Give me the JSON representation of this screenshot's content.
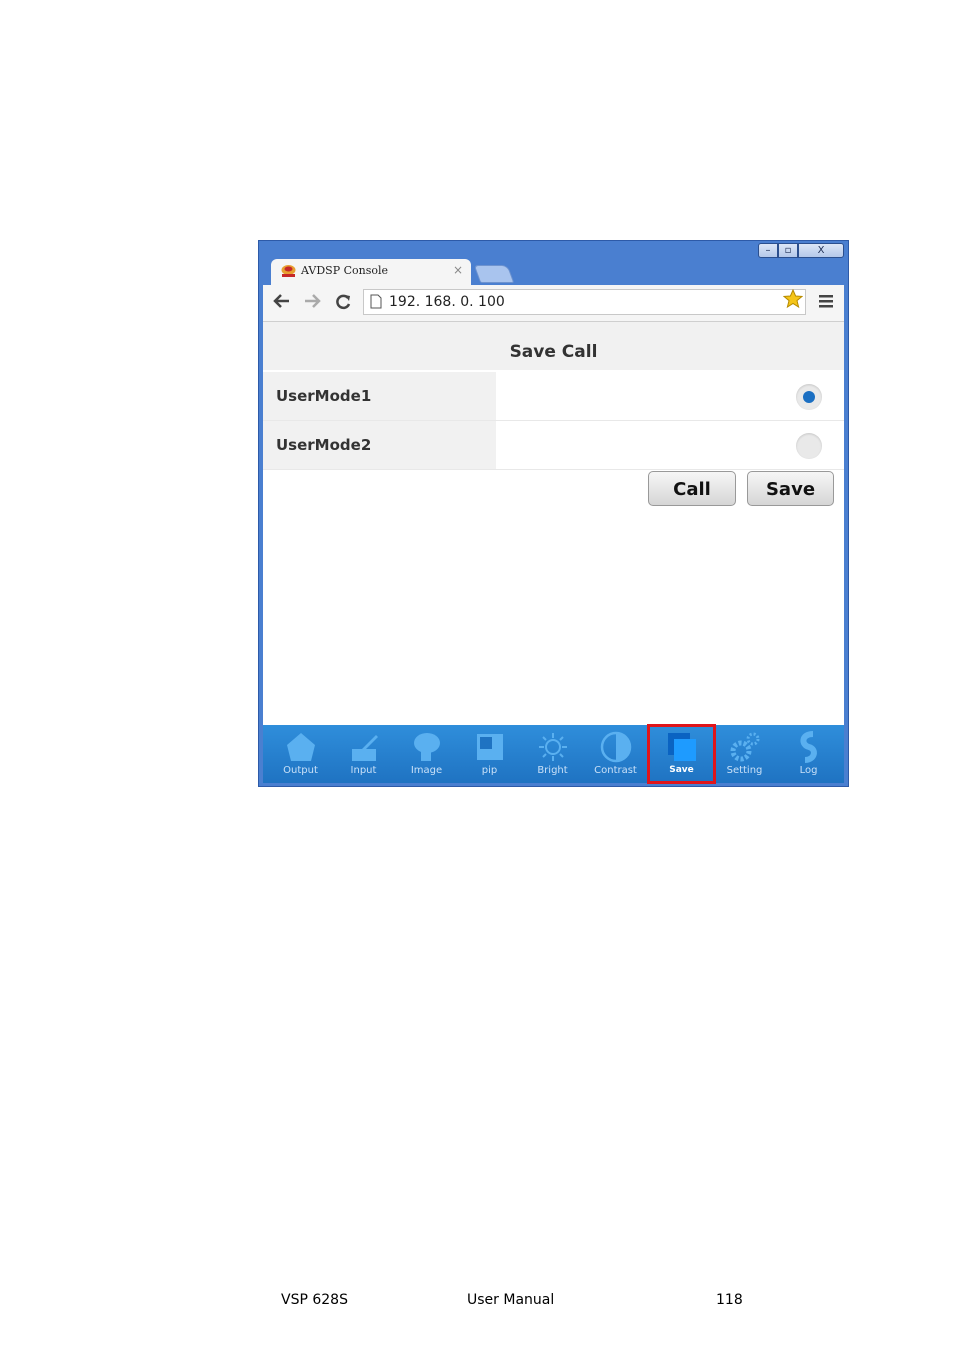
{
  "browser": {
    "tab_title": "AVDSP Console",
    "tab_close": "×",
    "url": "192. 168. 0. 100",
    "window_controls": {
      "close": "X"
    }
  },
  "page": {
    "title": "Save Call",
    "modes": [
      {
        "label": "UserMode1",
        "selected": true
      },
      {
        "label": "UserMode2",
        "selected": false
      }
    ],
    "buttons": {
      "call": "Call",
      "save": "Save"
    }
  },
  "nav": {
    "items": [
      {
        "label": "Output",
        "icon": "output-icon"
      },
      {
        "label": "Input",
        "icon": "input-icon"
      },
      {
        "label": "Image",
        "icon": "image-icon"
      },
      {
        "label": "pip",
        "icon": "pip-icon"
      },
      {
        "label": "Bright",
        "icon": "bright-icon"
      },
      {
        "label": "Contrast",
        "icon": "contrast-icon"
      },
      {
        "label": "Save",
        "icon": "save-icon",
        "active": true
      },
      {
        "label": "Setting",
        "icon": "gear-icon"
      },
      {
        "label": "Log",
        "icon": "log-icon"
      }
    ],
    "highlight_color": "#e0151b"
  },
  "footer": {
    "product": "VSP 628S",
    "doc": "User Manual",
    "page_number": "118"
  }
}
